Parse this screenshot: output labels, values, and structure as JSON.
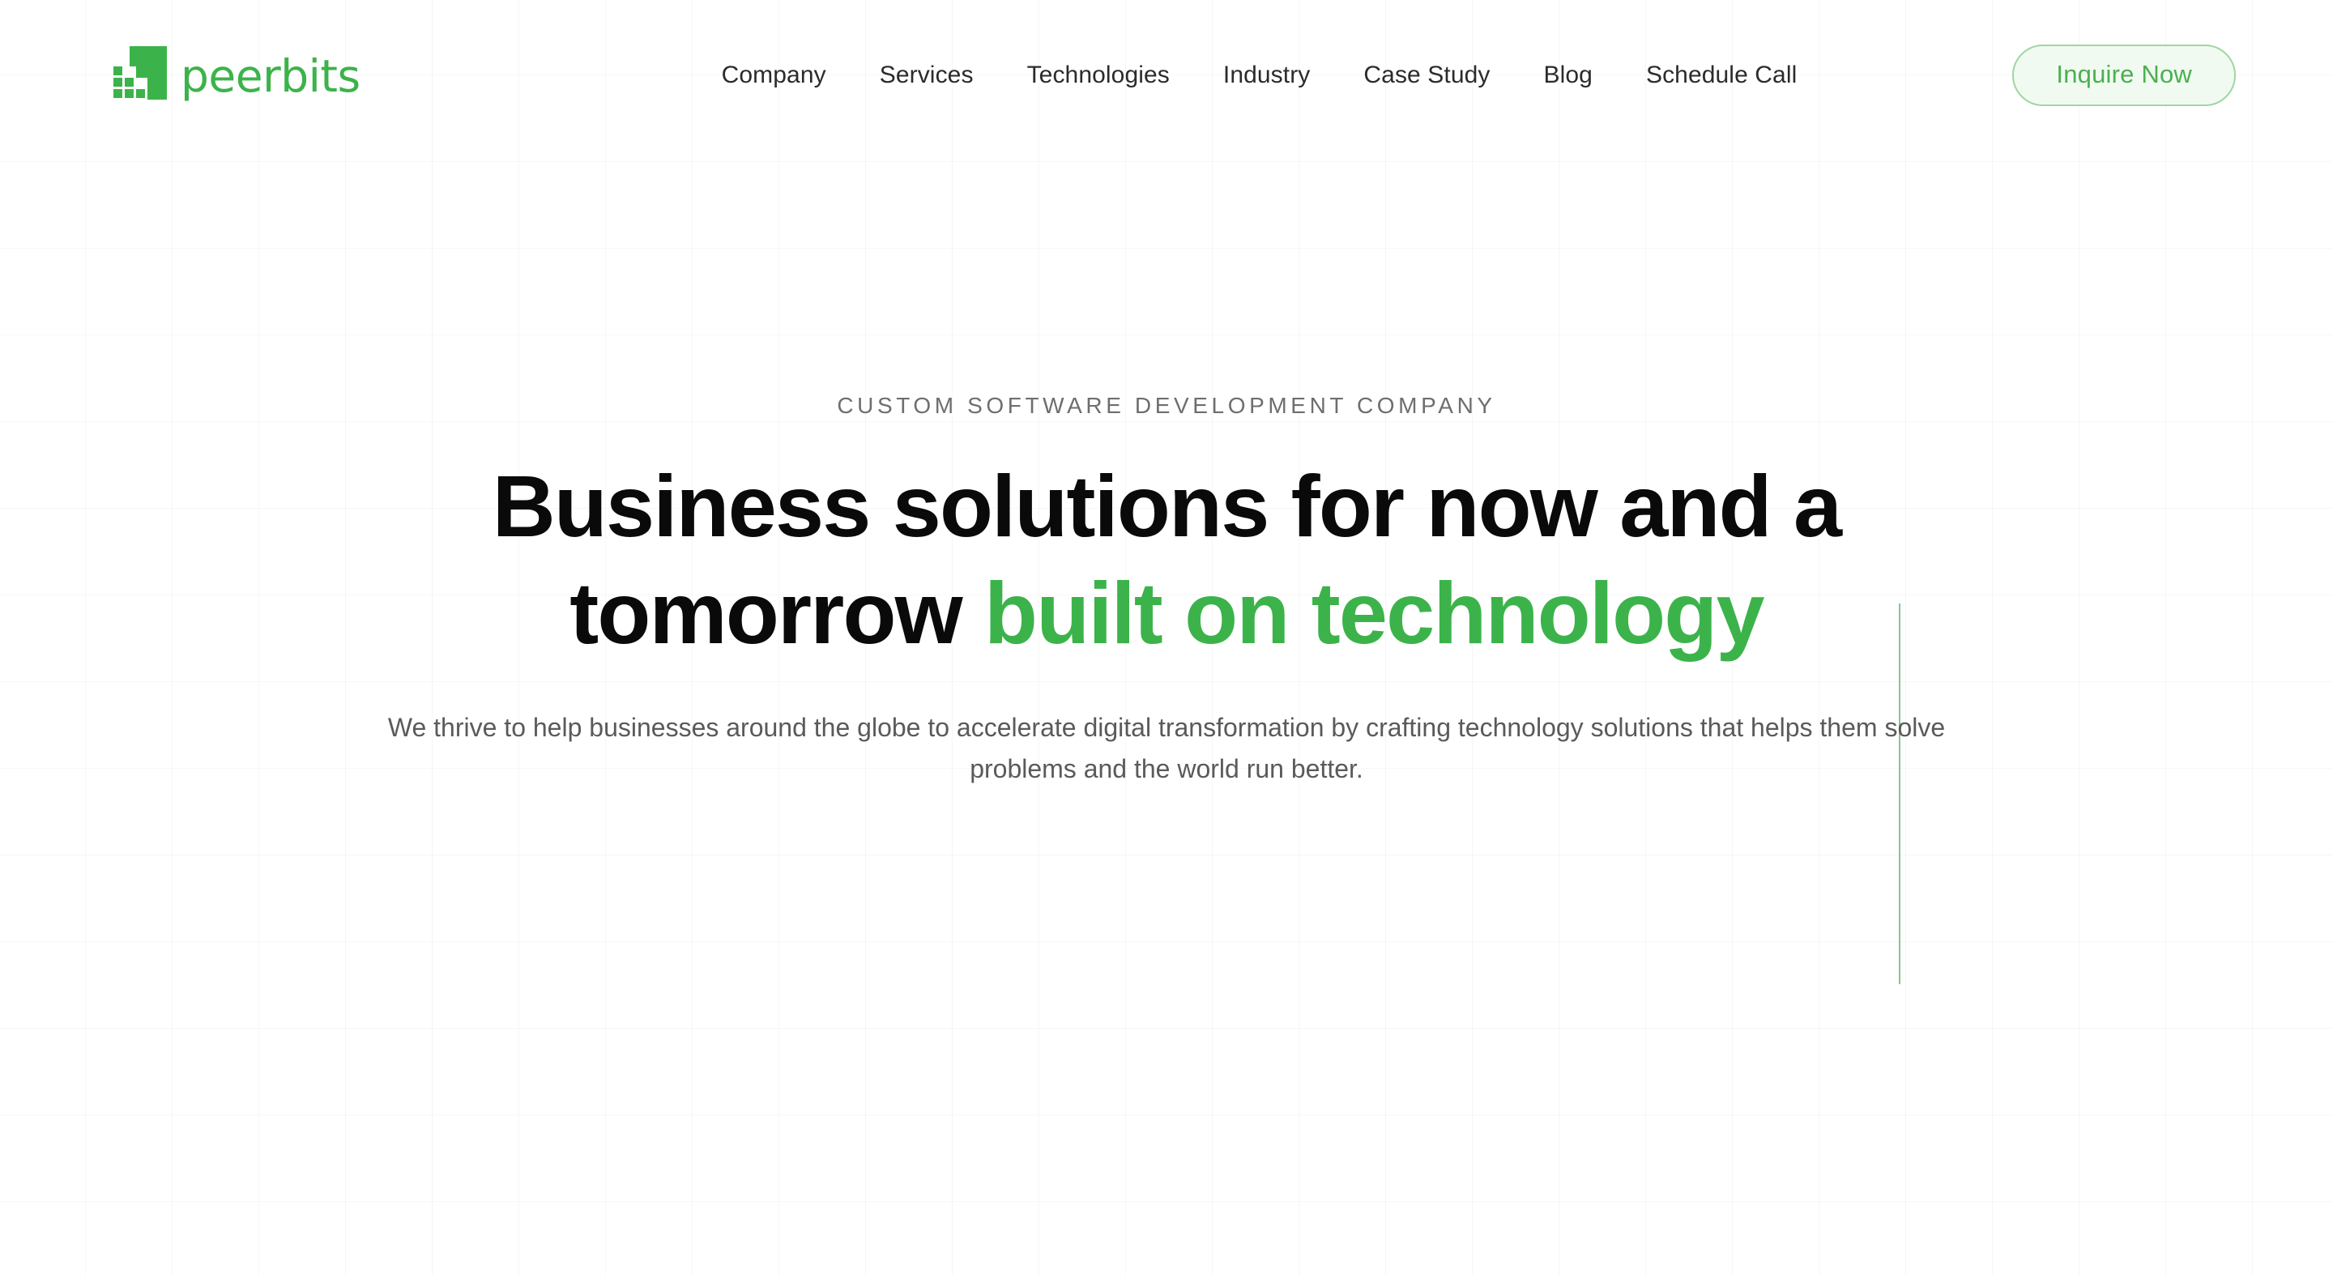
{
  "brand": {
    "name": "peerbits",
    "logo_icon": "peerbits-pixel-square-logo",
    "green": "#3cb34a",
    "light_green_bg": "#f1faf1",
    "border_green": "#9ed6a2"
  },
  "header": {
    "nav": [
      {
        "label": "Company"
      },
      {
        "label": "Services"
      },
      {
        "label": "Technologies"
      },
      {
        "label": "Industry"
      },
      {
        "label": "Case Study"
      },
      {
        "label": "Blog"
      },
      {
        "label": "Schedule Call"
      }
    ],
    "cta": {
      "label": "Inquire Now"
    }
  },
  "hero": {
    "eyebrow": "CUSTOM SOFTWARE DEVELOPMENT COMPANY",
    "title_line1": "Business solutions for now and a",
    "title_line2_plain": "tomorrow ",
    "title_line2_accent": "built on technology",
    "subtitle": "We thrive to help businesses around the globe to accelerate digital transformation by crafting technology solutions that helps them solve problems and the world run better."
  }
}
